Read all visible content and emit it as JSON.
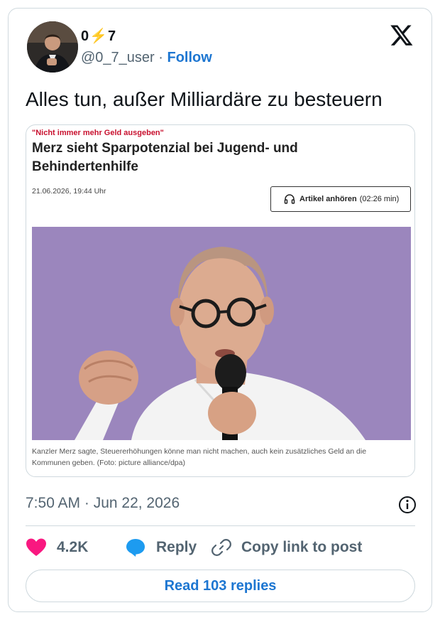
{
  "author": {
    "name_pre": "0",
    "name_bolt": "⚡",
    "name_post": "7",
    "handle": "@0_7_user",
    "separator": " · ",
    "follow_label": "Follow"
  },
  "tweet": {
    "text": "Alles tun, außer Milliardäre zu besteuern",
    "timestamp": "7:50 AM · Jun 22, 2026"
  },
  "embedded_article": {
    "kicker": "\"Nicht immer mehr Geld ausgeben\"",
    "headline": "Merz sieht Sparpotenzial bei Jugend- und Behindertenhilfe",
    "dateline": "21.06.2026, 19:44 Uhr",
    "listen_label": "Artikel anhören",
    "listen_duration": "(02:26 min)",
    "caption": "Kanzler Merz sagte, Steuererhöhungen könne man nicht machen, auch kein zusätzliches Geld an die Kommunen geben. (Foto: picture alliance/dpa)"
  },
  "actions": {
    "like_count": "4.2K",
    "reply_label": "Reply",
    "copy_label": "Copy link to post"
  },
  "read_replies_label": "Read 103 replies",
  "colors": {
    "accent": "#1d76d1",
    "like": "#f91880",
    "reply": "#1d9bf0",
    "kicker": "#c8102e",
    "photo_background": "#9b86bd"
  },
  "icons": [
    "x-logo-icon",
    "headphones-icon",
    "info-icon",
    "heart-icon",
    "reply-bubble-icon",
    "link-icon"
  ]
}
